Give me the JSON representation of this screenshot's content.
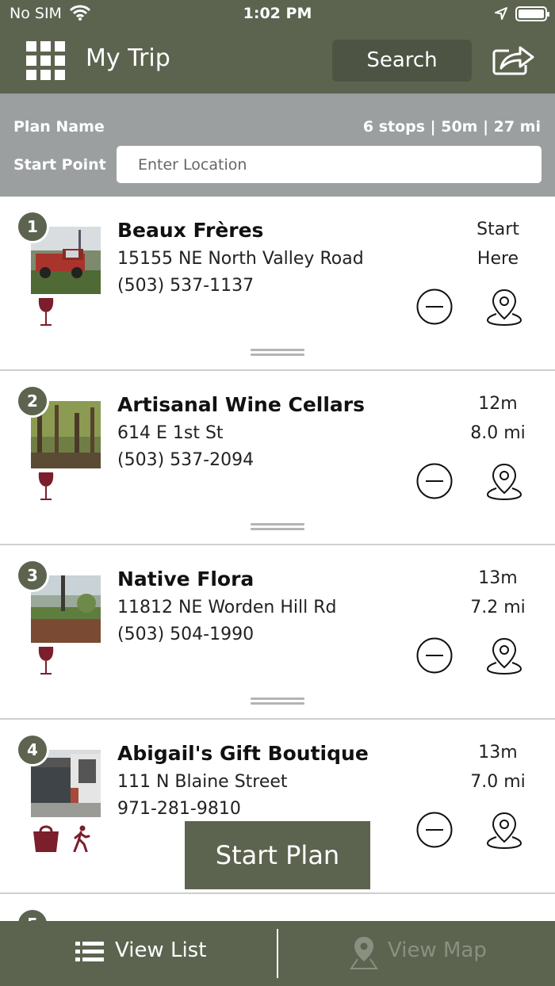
{
  "status_bar": {
    "carrier": "No SIM",
    "time": "1:02 PM"
  },
  "header": {
    "title": "My Trip",
    "search_label": "Search"
  },
  "plan": {
    "plan_name_label": "Plan Name",
    "stats": "6 stops | 50m | 27 mi",
    "start_point_label": "Start Point",
    "start_point_placeholder": "Enter Location"
  },
  "stops": [
    {
      "number": "1",
      "name": "Beaux Frères",
      "address": "15155 NE North Valley Road",
      "phone": "(503) 537-1137",
      "time": "Start",
      "distance": "Here",
      "categories": [
        "wine-glass-icon"
      ]
    },
    {
      "number": "2",
      "name": "Artisanal Wine Cellars",
      "address": "614 E 1st St",
      "phone": "(503) 537-2094",
      "time": "12m",
      "distance": "8.0 mi",
      "categories": [
        "wine-glass-icon"
      ]
    },
    {
      "number": "3",
      "name": "Native Flora",
      "address": "11812 NE Worden Hill Rd",
      "phone": "(503) 504-1990",
      "time": "13m",
      "distance": "7.2 mi",
      "categories": [
        "wine-glass-icon"
      ]
    },
    {
      "number": "4",
      "name": "Abigail's Gift Boutique",
      "address": "111 N Blaine Street",
      "phone": "971-281-9810",
      "time": "13m",
      "distance": "7.0 mi",
      "categories": [
        "shopping-bag-icon",
        "walking-icon"
      ]
    },
    {
      "number": "5"
    }
  ],
  "start_plan_label": "Start Plan",
  "tabs": {
    "list_label": "View List",
    "map_label": "View Map"
  },
  "colors": {
    "olive": "#5c6450",
    "olive_dark": "#4d5443",
    "plan_bar": "#9b9fa0",
    "wine": "#7a1f2b"
  }
}
